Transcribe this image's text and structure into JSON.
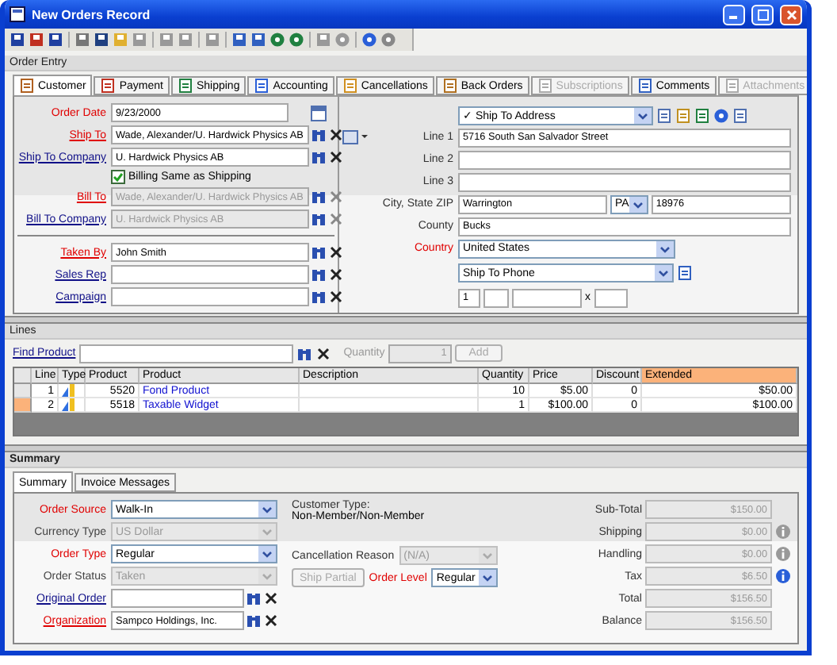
{
  "window": {
    "title": "New Orders Record"
  },
  "order_entry": {
    "title": "Order Entry",
    "tabs": [
      {
        "label": "Customer",
        "selected": true,
        "disabled": false
      },
      {
        "label": "Payment",
        "selected": false,
        "disabled": false
      },
      {
        "label": "Shipping",
        "selected": false,
        "disabled": false
      },
      {
        "label": "Accounting",
        "selected": false,
        "disabled": false
      },
      {
        "label": "Cancellations",
        "selected": false,
        "disabled": false
      },
      {
        "label": "Back Orders",
        "selected": false,
        "disabled": false
      },
      {
        "label": "Subscriptions",
        "selected": false,
        "disabled": true
      },
      {
        "label": "Comments",
        "selected": false,
        "disabled": false
      },
      {
        "label": "Attachments",
        "selected": false,
        "disabled": true
      }
    ],
    "customer_fields": [
      {
        "label": "Order Date",
        "required": true,
        "link": false,
        "kind": "date",
        "value": "9/23/2000",
        "disabled": false
      },
      {
        "label": "Ship To",
        "required": true,
        "link": true,
        "kind": "lookup",
        "value": "Wade, Alexander/U. Hardwick Physics AB",
        "disabled": false
      },
      {
        "label": "Ship To Company",
        "required": false,
        "link": true,
        "kind": "lookup",
        "value": "U. Hardwick Physics AB",
        "disabled": false
      },
      {
        "label": "Billing Same as Shipping",
        "kind": "checkbox",
        "checked": true
      },
      {
        "label": "Bill To",
        "required": true,
        "link": true,
        "kind": "lookup",
        "value": "Wade, Alexander/U. Hardwick Physics AB",
        "disabled": true
      },
      {
        "label": "Bill To Company",
        "required": false,
        "link": true,
        "kind": "lookup",
        "value": "U. Hardwick Physics AB",
        "disabled": true
      }
    ],
    "staff_fields": [
      {
        "label": "Taken By",
        "required": true,
        "link": true,
        "kind": "lookup",
        "value": "John Smith",
        "disabled": false
      },
      {
        "label": "Sales Rep",
        "required": false,
        "link": true,
        "kind": "lookup",
        "disabled": false
      },
      {
        "label": "Campaign",
        "required": false,
        "link": true,
        "kind": "lookup",
        "disabled": false
      }
    ],
    "address": {
      "type_select": "✓ Ship To Address",
      "lines": [
        {
          "label": "Line 1",
          "value": "5716 South San Salvador Street"
        },
        {
          "label": "Line 2"
        },
        {
          "label": "Line 3"
        }
      ],
      "city_label": "City, State ZIP",
      "city": "Warrington",
      "state": "PA",
      "zip": "18976",
      "county_label": "County",
      "county": "Bucks",
      "country_label": "Country",
      "country": "United States",
      "phone_select": "Ship To Phone",
      "phone_country_code": "1",
      "extension_mark": "x"
    }
  },
  "lines": {
    "title": "Lines",
    "find_label": "Find Product",
    "quantity_label": "Quantity",
    "quantity": "1",
    "add_button": "Add",
    "columns": [
      {
        "label": "Line",
        "selected": false
      },
      {
        "label": "Type",
        "selected": false
      },
      {
        "label": "Product",
        "selected": false
      },
      {
        "label": "Product",
        "selected": false
      },
      {
        "label": "Description",
        "selected": false
      },
      {
        "label": "Quantity",
        "selected": false
      },
      {
        "label": "Price",
        "selected": false
      },
      {
        "label": "Discount",
        "selected": false
      },
      {
        "label": "Extended",
        "selected": true
      }
    ],
    "rows": [
      {
        "selected": false,
        "line": "1",
        "product_id": "5520",
        "product": "Fond Product",
        "quantity": "10",
        "price": "$5.00",
        "discount": "0",
        "extended": "$50.00"
      },
      {
        "selected": true,
        "line": "2",
        "product_id": "5518",
        "product": "Taxable Widget",
        "quantity": "1",
        "price": "$100.00",
        "discount": "0",
        "extended": "$100.00"
      }
    ]
  },
  "summary": {
    "title": "Summary",
    "tabs": [
      {
        "label": "Summary",
        "selected": true
      },
      {
        "label": "Invoice Messages",
        "selected": false
      }
    ],
    "fields": [
      {
        "label": "Order Source",
        "required": true,
        "link": false,
        "kind": "select",
        "value": "Walk-In",
        "disabled": false
      },
      {
        "label": "Currency Type",
        "required": false,
        "link": false,
        "kind": "select",
        "value": "US Dollar",
        "disabled": true
      },
      {
        "label": "Order Type",
        "required": true,
        "link": false,
        "kind": "select",
        "value": "Regular",
        "disabled": false
      },
      {
        "label": "Order Status",
        "required": false,
        "link": false,
        "kind": "select",
        "value": "Taken",
        "disabled": true
      },
      {
        "label": "Original Order",
        "required": false,
        "link": true,
        "kind": "lookup",
        "disabled": false
      },
      {
        "label": "Organization",
        "required": true,
        "link": true,
        "kind": "lookup",
        "value": "Sampco Holdings, Inc.",
        "disabled": false
      }
    ],
    "customer_type_label": "Customer Type:",
    "customer_type": "Non-Member/Non-Member",
    "cancellation": {
      "label": "Cancellation Reason",
      "value": "(N/A)",
      "disabled": true
    },
    "ship_partial": {
      "label": "Ship Partial",
      "disabled": true
    },
    "order_level": {
      "label": "Order Level",
      "required": true,
      "value": "Regular"
    },
    "totals": [
      {
        "label": "Sub-Total",
        "value": "$150.00"
      },
      {
        "label": "Shipping",
        "value": "$0.00",
        "info_enabled": false
      },
      {
        "label": "Handling",
        "value": "$0.00",
        "info_enabled": false
      },
      {
        "label": "Tax",
        "value": "$6.50",
        "info_enabled": true
      },
      {
        "label": "Total",
        "value": "$156.50"
      },
      {
        "label": "Balance",
        "value": "$156.50"
      }
    ]
  }
}
